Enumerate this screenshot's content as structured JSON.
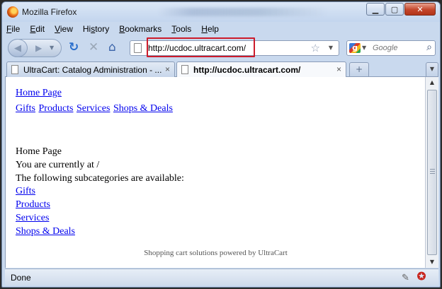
{
  "window": {
    "title": "Mozilla Firefox",
    "controls": [
      "minimize",
      "maximize",
      "close"
    ]
  },
  "menu": {
    "items": [
      {
        "label": "File",
        "key": "F",
        "rest": "ile"
      },
      {
        "label": "Edit",
        "key": "E",
        "rest": "dit"
      },
      {
        "label": "View",
        "key": "V",
        "rest": "iew"
      },
      {
        "label": "History",
        "key": "s",
        "pre": "Hi",
        "rest": "tory"
      },
      {
        "label": "Bookmarks",
        "key": "B",
        "rest": "ookmarks"
      },
      {
        "label": "Tools",
        "key": "T",
        "rest": "ools"
      },
      {
        "label": "Help",
        "key": "H",
        "rest": "elp"
      }
    ]
  },
  "navbar": {
    "url": "http://ucdoc.ultracart.com/",
    "search_placeholder": "Google",
    "highlight_color": "#cc1b2b"
  },
  "tabs": [
    {
      "label": "UltraCart: Catalog Administration - ...",
      "active": false
    },
    {
      "label": "http://ucdoc.ultracart.com/",
      "active": true
    }
  ],
  "content": {
    "home_link": "Home Page",
    "categories": [
      "Gifts",
      "Products",
      "Services",
      "Shops & Deals"
    ],
    "heading": "Home Page",
    "location_text": "You are currently at /",
    "subcat_intro": "The following subcategories are available:",
    "subcategories": [
      "Gifts",
      "Products",
      "Services",
      "Shops & Deals"
    ],
    "footer": "Shopping cart solutions powered by UltraCart",
    "link_color": "#0000ee"
  },
  "status": {
    "text": "Done"
  }
}
